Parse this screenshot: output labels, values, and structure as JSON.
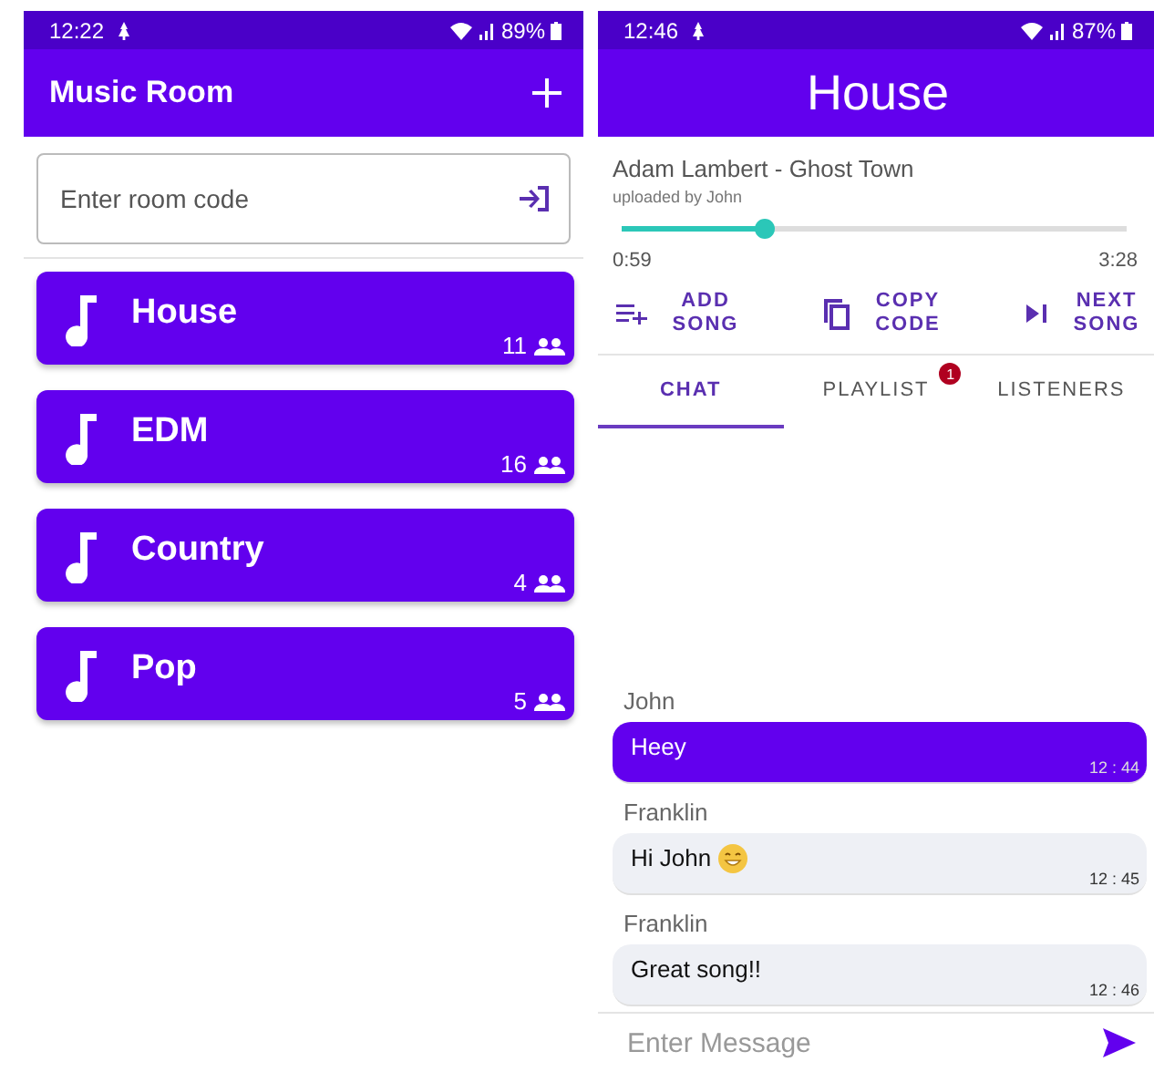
{
  "room_list": {
    "status_bar": {
      "time": "12:22",
      "battery": "89%"
    },
    "title": "Music Room",
    "room_code_field": {
      "placeholder": "Enter room code"
    },
    "rooms": [
      {
        "name": "House",
        "listeners": "11"
      },
      {
        "name": "EDM",
        "listeners": "16"
      },
      {
        "name": "Country",
        "listeners": "4"
      },
      {
        "name": "Pop",
        "listeners": "5"
      }
    ]
  },
  "room": {
    "status_bar": {
      "time": "12:46",
      "battery": "87%"
    },
    "title": "House",
    "song": {
      "title": "Adam Lambert - Ghost Town",
      "uploader": "uploaded by John",
      "level": 0.28,
      "elapsed": "0:59",
      "duration": "3:28"
    },
    "actions": [
      {
        "kind": "add",
        "label": "ADD SONG"
      },
      {
        "kind": "copy",
        "label": "COPY CODE"
      },
      {
        "kind": "next",
        "label": "NEXT SONG"
      }
    ],
    "tabs": [
      {
        "label": "CHAT",
        "selected": true
      },
      {
        "label": "PLAYLIST",
        "selected": false,
        "badge": "1"
      },
      {
        "label": "LISTENERS",
        "selected": false
      }
    ],
    "messages": [
      {
        "sender": "John",
        "text": "Heey",
        "time": "12 : 44",
        "outgoing": true,
        "emoji": false
      },
      {
        "sender": "Franklin",
        "text": "Hi John",
        "time": "12 : 45",
        "outgoing": false,
        "emoji": true
      },
      {
        "sender": "Franklin",
        "text": "Great song!!",
        "time": "12 : 46",
        "outgoing": false,
        "emoji": false
      }
    ],
    "message_field": {
      "placeholder": "Enter Message"
    }
  }
}
